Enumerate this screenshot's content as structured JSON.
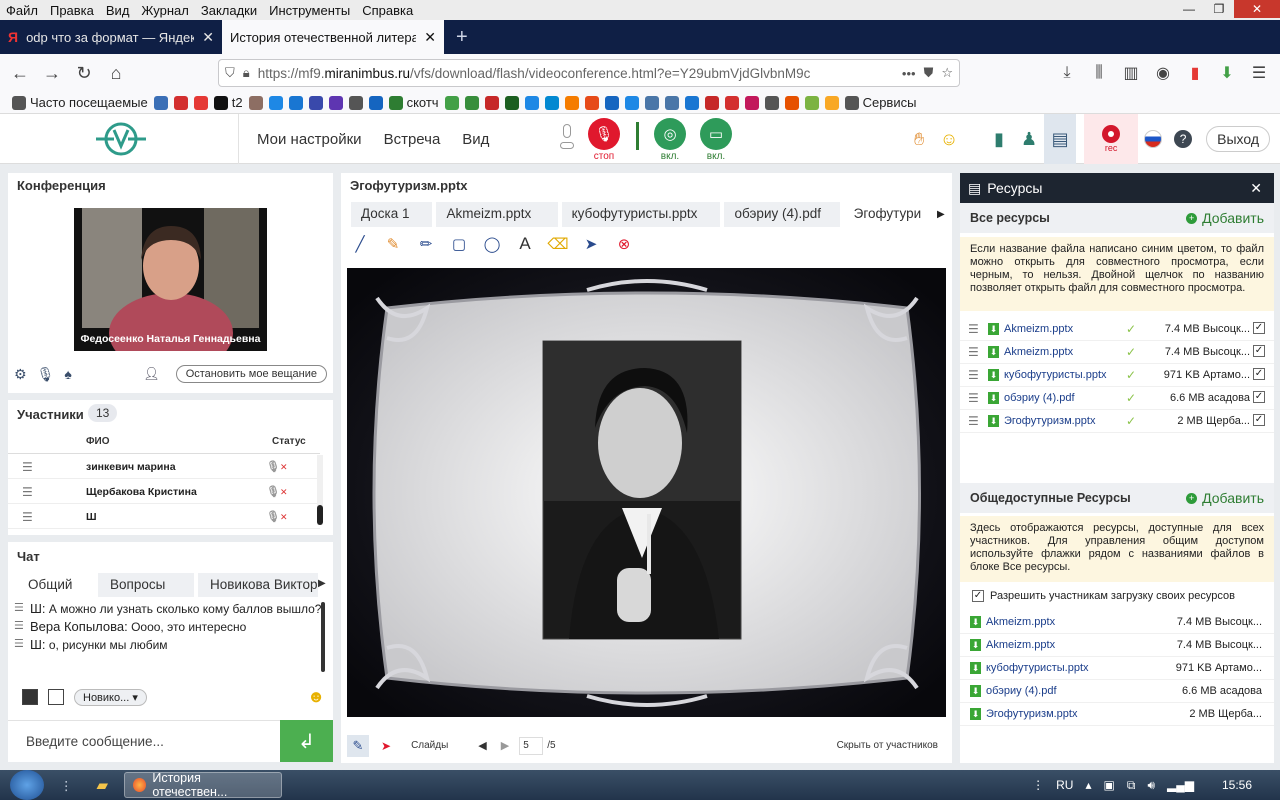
{
  "browser": {
    "menu": [
      "Файл",
      "Правка",
      "Вид",
      "Журнал",
      "Закладки",
      "Инструменты",
      "Справка"
    ],
    "tabs": [
      {
        "title": "odp что за формат — Яндекс",
        "favicon": "yandex-icon",
        "active": false
      },
      {
        "title": "История отечественной литерату",
        "favicon": "none",
        "active": true
      }
    ],
    "url": {
      "host": "https://mf9.",
      "domain": "miranimbus.ru",
      "path": "/vfs/download/flash/videoconference.html?e=Y29ubmVjdGlvbnM9c"
    },
    "bookmarks": [
      {
        "label": "Часто посещаемые",
        "icon": "gear-icon",
        "color": "#555555"
      },
      {
        "label": "",
        "icon": "bookmark-icon",
        "color": "#3b6fb6"
      },
      {
        "label": "",
        "icon": "rzd-icon",
        "color": "#d32f2f"
      },
      {
        "label": "",
        "icon": "ufs-icon",
        "color": "#e53935"
      },
      {
        "label": "t2",
        "icon": "t2-icon",
        "color": "#111111"
      },
      {
        "label": "",
        "icon": "globe-icon",
        "color": "#8d6e63"
      },
      {
        "label": "",
        "icon": "globe-icon",
        "color": "#1e88e5"
      },
      {
        "label": "",
        "icon": "pin-icon",
        "color": "#1976d2"
      },
      {
        "label": "",
        "icon": "bp-icon",
        "color": "#3949ab"
      },
      {
        "label": "",
        "icon": "pp-icon",
        "color": "#5e35b1"
      },
      {
        "label": "",
        "icon": "globe-icon",
        "color": "#555555"
      },
      {
        "label": "",
        "icon": "flag-icon",
        "color": "#1565c0"
      },
      {
        "label": "скотч",
        "icon": "skotch-icon",
        "color": "#2e7d32"
      },
      {
        "label": "",
        "icon": "leaf-icon",
        "color": "#43a047"
      },
      {
        "label": "",
        "icon": "shield-icon",
        "color": "#388e3c"
      },
      {
        "label": "",
        "icon": "box-icon",
        "color": "#c62828"
      },
      {
        "label": "",
        "icon": "emblem-icon",
        "color": "#1b5e20"
      },
      {
        "label": "",
        "icon": "eagle-icon",
        "color": "#1e88e5"
      },
      {
        "label": "",
        "icon": "edge-icon",
        "color": "#0288d1"
      },
      {
        "label": "",
        "icon": "diamond-icon",
        "color": "#f57c00"
      },
      {
        "label": "",
        "icon": "g-icon",
        "color": "#e64a19"
      },
      {
        "label": "",
        "icon": "wave-icon",
        "color": "#1565c0"
      },
      {
        "label": "",
        "icon": "check-icon",
        "color": "#1e88e5"
      },
      {
        "label": "",
        "icon": "vk-icon",
        "color": "#4a76a8"
      },
      {
        "label": "",
        "icon": "vk-icon",
        "color": "#4a76a8"
      },
      {
        "label": "",
        "icon": "mail-icon",
        "color": "#1976d2"
      },
      {
        "label": "",
        "icon": "copyright-icon",
        "color": "#c62828"
      },
      {
        "label": "",
        "icon": "flag-icon",
        "color": "#d32f2f"
      },
      {
        "label": "",
        "icon": "instagram-icon",
        "color": "#c2185b"
      },
      {
        "label": "",
        "icon": "globe-icon",
        "color": "#555555"
      },
      {
        "label": "",
        "icon": "tm-icon",
        "color": "#e65100"
      },
      {
        "label": "",
        "icon": "s-icon",
        "color": "#7cb342"
      },
      {
        "label": "",
        "icon": "envelope-icon",
        "color": "#f9a825"
      },
      {
        "label": "Сервисы",
        "icon": "folder-icon",
        "color": "#555555"
      }
    ]
  },
  "app": {
    "nav": [
      "Мои настройки",
      "Встреча",
      "Вид"
    ],
    "controls": [
      {
        "label": "стоп",
        "icon": "microphone-icon",
        "color": "#e0182d",
        "label_color": "#e0182d"
      },
      {
        "label": "вкл.",
        "icon": "webcam-icon",
        "color": "#2e9b5a",
        "label_color": "#2e7d32"
      },
      {
        "label": "вкл.",
        "icon": "screen-icon",
        "color": "#2e9b5a",
        "label_color": "#2e7d32"
      }
    ],
    "rec_label": "rec",
    "exit_label": "Выход",
    "accent": "#2e9b5a"
  },
  "conference": {
    "title": "Конференция",
    "speaker": "Федосеенко Наталья Геннадьевна",
    "stop_label": "Остановить мое вещание"
  },
  "participants": {
    "title": "Участники",
    "count": "13",
    "col_name": "ФИО",
    "col_status": "Статус",
    "rows": [
      "зинкевич марина",
      "Щербакова Кристина",
      "Ш"
    ]
  },
  "chat": {
    "title": "Чат",
    "tabs": [
      "Общий",
      "Вопросы",
      "Новикова Виктор"
    ],
    "messages": [
      {
        "author": "Ш:",
        "text": "А можно ли узнать сколько кому баллов вышло?"
      },
      {
        "author": "Вера Копылова:",
        "text": "Оооо, это интересно"
      },
      {
        "author": "Ш:",
        "text": "о, рисунки мы любим"
      }
    ],
    "recipient": "Новико...",
    "input_placeholder": "Введите сообщение..."
  },
  "presentation": {
    "title": "Эгофутуризм.pptx",
    "tabs": [
      "Доска 1",
      "Akmeizm.pptx",
      "кубофутуристы.pptx",
      "обэриу (4).pdf",
      "Эгофутури"
    ],
    "slides_label": "Слайды",
    "page_current": "5",
    "page_total": "/5",
    "hide_label": "Скрыть от участников"
  },
  "resources": {
    "title": "Ресурсы",
    "all_title": "Все ресурсы",
    "add_label": "Добавить",
    "all_note": "Если название файла написано синим цветом, то файл можно открыть для совместного просмотра, если черным, то нельзя. Двойной щелчок по названию позволяет открыть файл для совместного просмотра.",
    "all_files": [
      {
        "name": "Akmeizm.pptx",
        "size": "7.4 MB",
        "owner": "Высоцк..."
      },
      {
        "name": "Akmeizm.pptx",
        "size": "7.4 MB",
        "owner": "Высоцк..."
      },
      {
        "name": "кубофутуристы.pptx",
        "size": "971 KB",
        "owner": "Артамо..."
      },
      {
        "name": "обэриу (4).pdf",
        "size": "6.6 MB",
        "owner": "асадова"
      },
      {
        "name": "Эгофутуризм.pptx",
        "size": "2 MB",
        "owner": "Щерба..."
      }
    ],
    "public_title": "Общедоступные Ресурсы",
    "public_note": "Здесь отображаются ресурсы, доступные для всех участников. Для управления общим доступом используйте флажки рядом с названиями файлов в блоке Все ресурсы.",
    "permission": "Разрешить участникам загрузку своих ресурсов",
    "public_files": [
      {
        "name": "Akmeizm.pptx",
        "size": "7.4 MB",
        "owner": "Высоцк..."
      },
      {
        "name": "Akmeizm.pptx",
        "size": "7.4 MB",
        "owner": "Высоцк..."
      },
      {
        "name": "кубофутуристы.pptx",
        "size": "971 KB",
        "owner": "Артамо..."
      },
      {
        "name": "обэриу (4).pdf",
        "size": "6.6 MB",
        "owner": "асадова"
      },
      {
        "name": "Эгофутуризм.pptx",
        "size": "2 MB",
        "owner": "Щерба..."
      }
    ]
  },
  "taskbar": {
    "app_title": "История отечествен...",
    "lang": "RU",
    "time": "15:56"
  }
}
